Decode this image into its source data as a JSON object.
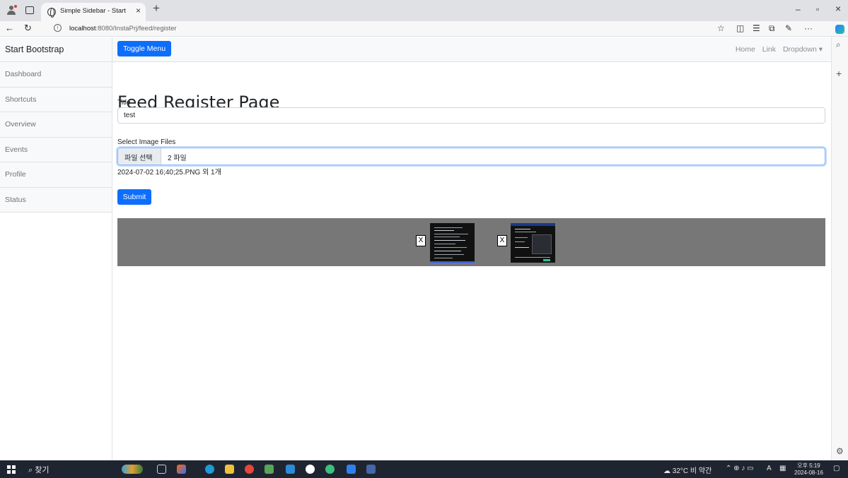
{
  "browser": {
    "tab_title": "Simple Sidebar - Start Bootstrap",
    "tab_close": "×",
    "new_tab": "+",
    "url_host": "localhost",
    "url_rest": ":8080/InstaPrj/feed/register",
    "minimize": "–",
    "restore": "▫",
    "close": "×"
  },
  "sidebar": {
    "heading": "Start Bootstrap",
    "items": [
      {
        "label": "Dashboard"
      },
      {
        "label": "Shortcuts"
      },
      {
        "label": "Overview"
      },
      {
        "label": "Events"
      },
      {
        "label": "Profile"
      },
      {
        "label": "Status"
      }
    ]
  },
  "navbar": {
    "toggle_label": "Toggle Menu",
    "links": [
      "Home",
      "Link",
      "Dropdown ▾"
    ]
  },
  "form": {
    "page_title": "Feed Register Page",
    "title_label": "Title",
    "title_value": "test",
    "files_label": "Select Image Files",
    "file_button": "파일 선택",
    "file_count": "2 파일",
    "file_names": "2024-07-02 16;40;25.PNG 외 1개",
    "submit_label": "Submit"
  },
  "preview": {
    "remove_label": "X",
    "items": [
      {
        "remove": "X"
      },
      {
        "remove": "X"
      }
    ]
  },
  "taskbar": {
    "search_label": "찾기",
    "weather": "32°C 비 약간",
    "ime": "A",
    "time": "오후 5:19",
    "date": "2024-08-16"
  },
  "colors": {
    "primary": "#0d6efd",
    "preview_bg": "#777777",
    "taskbar_bg": "#1f2530"
  }
}
